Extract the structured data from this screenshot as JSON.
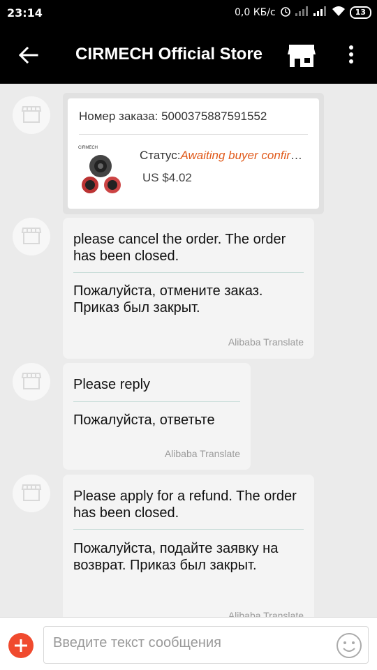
{
  "statusbar": {
    "time": "23:14",
    "net_speed": "0,0 КБ/с",
    "battery": "13",
    "icons": [
      "alarm-icon",
      "signal-icon",
      "signal-icon",
      "wifi-icon",
      "battery-icon"
    ]
  },
  "appbar": {
    "title": "CIRMECH Official Store",
    "icons": [
      "back-arrow-icon",
      "store-icon",
      "more-vert-icon"
    ]
  },
  "order": {
    "number_label": "Номер заказа:",
    "number": "5000375887591552",
    "status_label": "Статус:",
    "status_value": "Awaiting buyer confirmation",
    "price": "US $4.02",
    "image_brand": "CIRMECH"
  },
  "messages": [
    {
      "original": "please cancel the order. The order has been closed.",
      "translation": "Пожалуйста, отмените заказ. Приказ был закрыт.",
      "credit": "Alibaba Translate"
    },
    {
      "original": "Please reply",
      "translation": "Пожалуйста, ответьте",
      "credit": "Alibaba Translate"
    },
    {
      "original": "Please apply for a refund. The order has been closed.",
      "translation": "Пожалуйста, подайте заявку на возврат. Приказ был закрыт.",
      "credit": "Alibaba Translate"
    }
  ],
  "input": {
    "placeholder": "Введите текст сообщения"
  },
  "colors": {
    "accent": "#f04a2e",
    "status": "#e05a1b",
    "chat_bg": "#ebebeb",
    "bar_bg": "#000000"
  }
}
